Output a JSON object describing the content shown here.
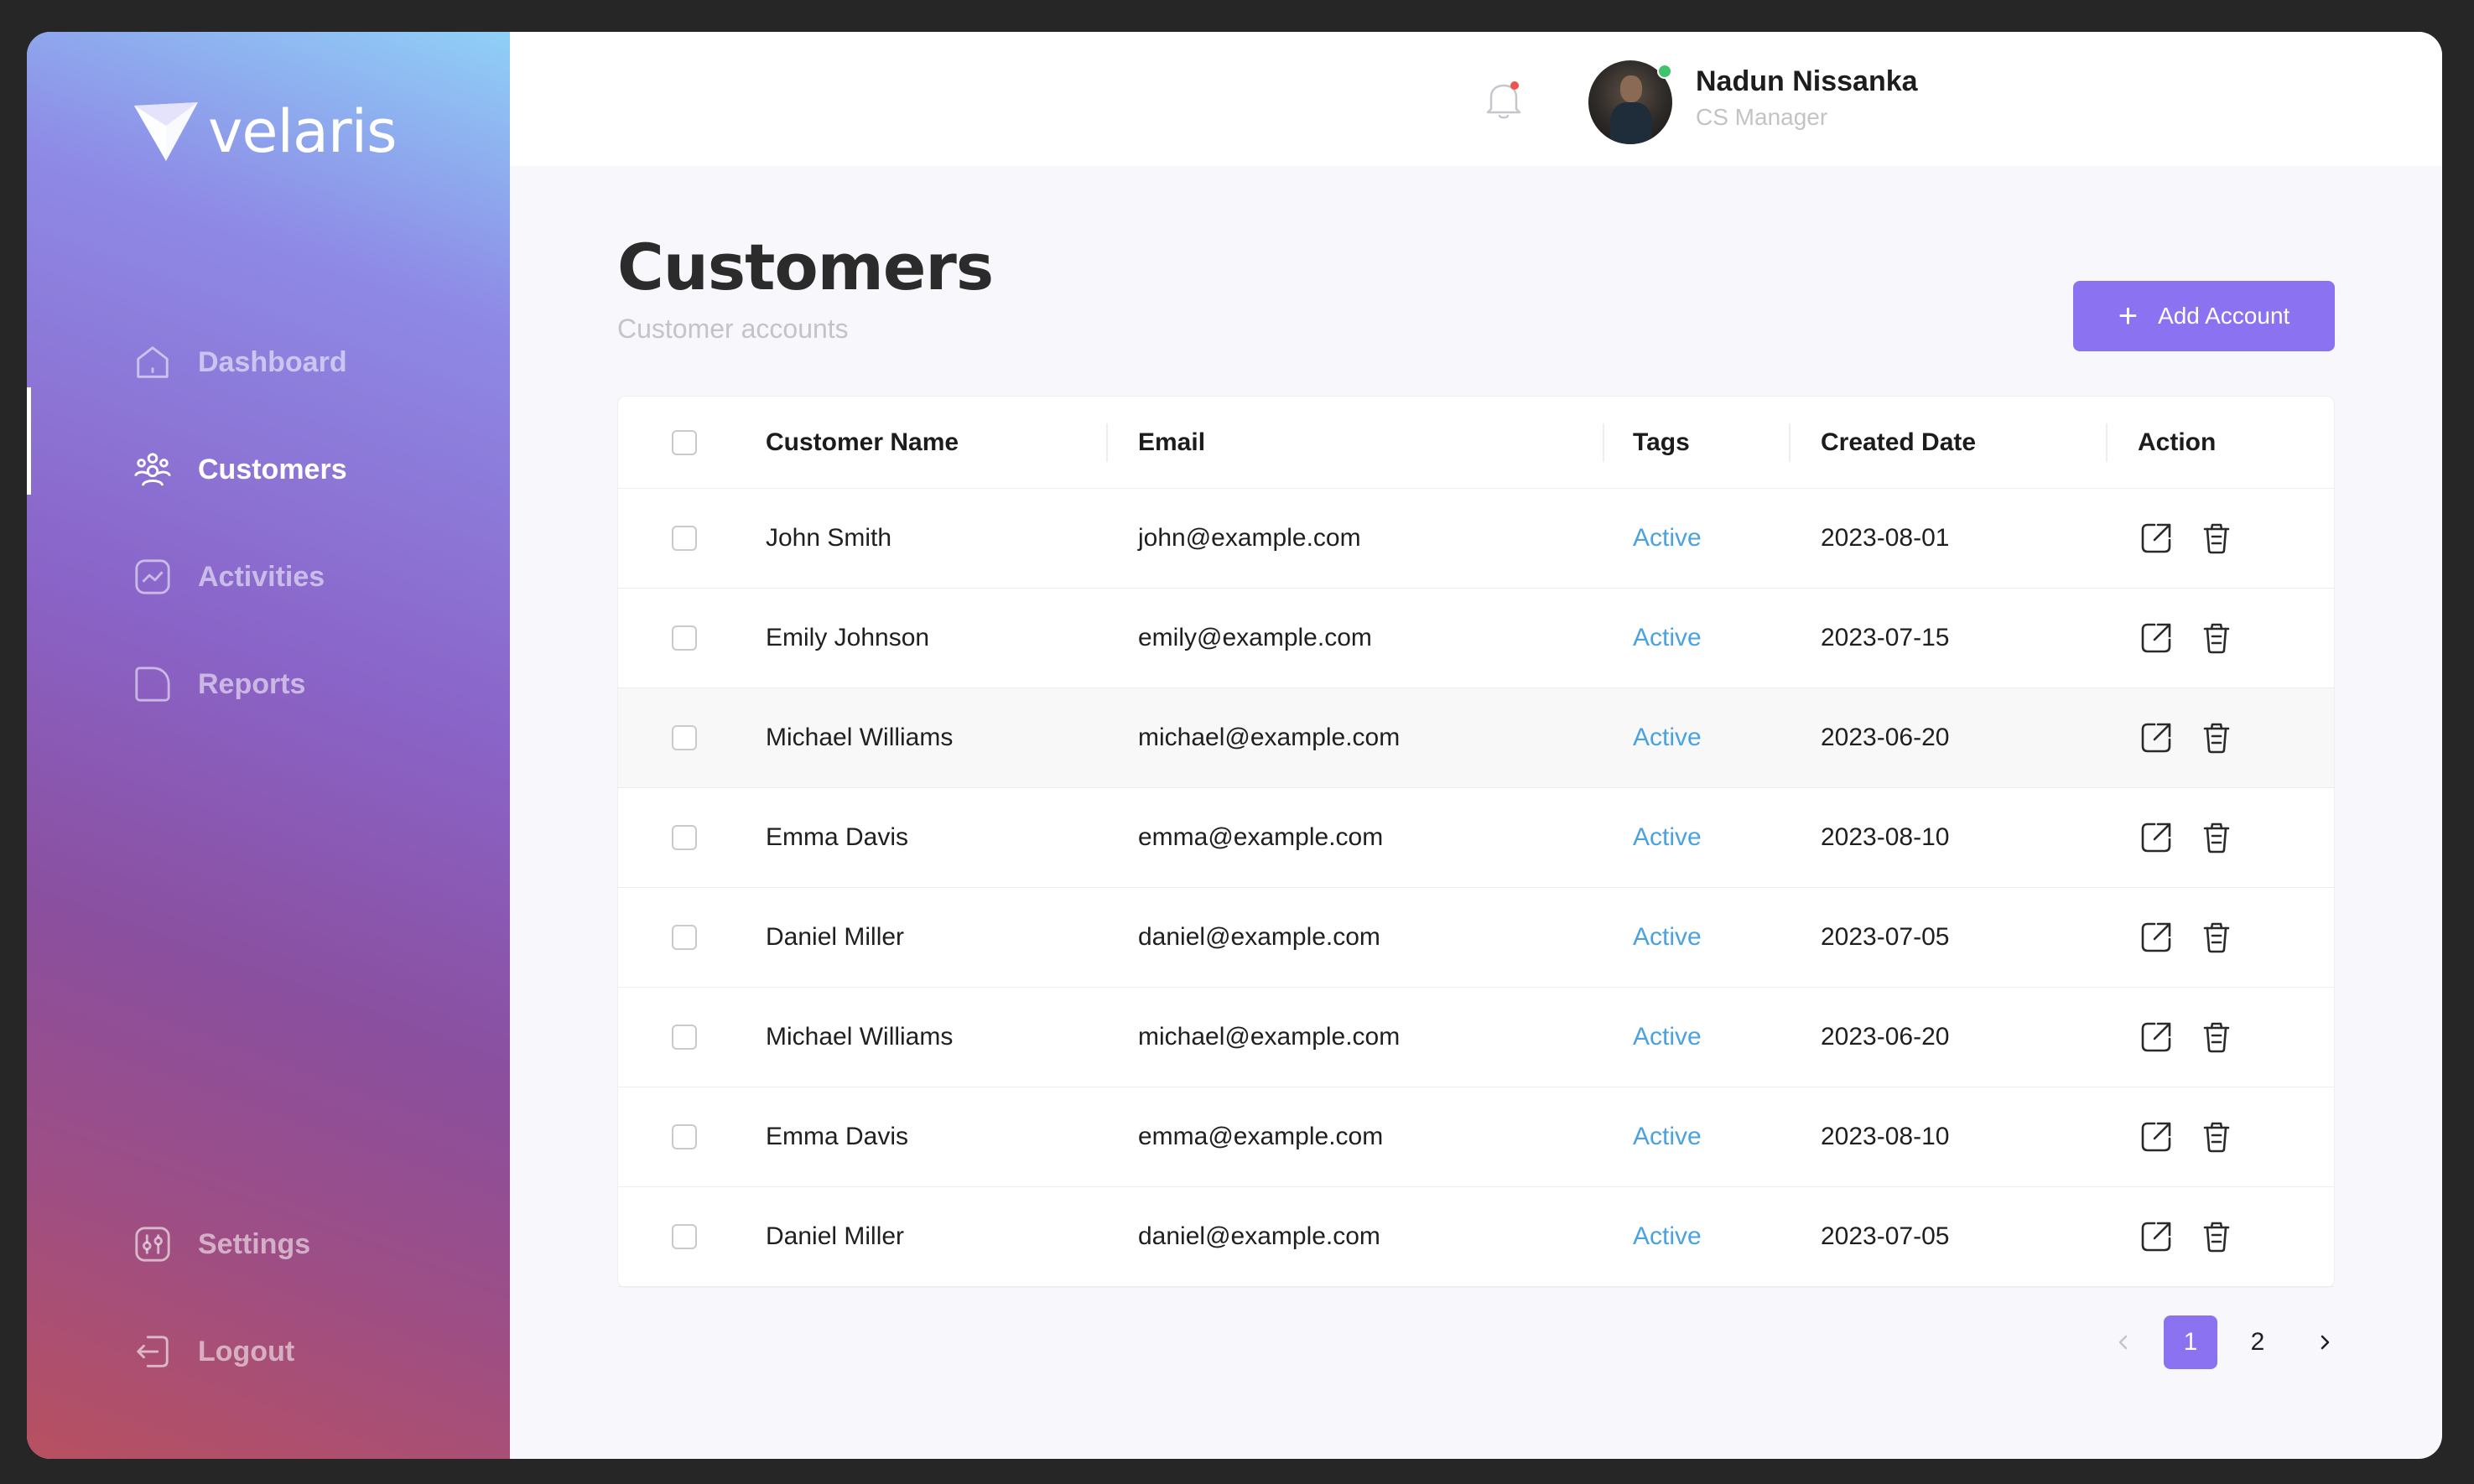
{
  "brand": {
    "name": "velaris"
  },
  "sidebar": {
    "items": [
      {
        "label": "Dashboard",
        "icon": "home-icon",
        "active": false
      },
      {
        "label": "Customers",
        "icon": "users-icon",
        "active": true
      },
      {
        "label": "Activities",
        "icon": "activity-chart-icon",
        "active": false
      },
      {
        "label": "Reports",
        "icon": "report-icon",
        "active": false
      }
    ],
    "bottom": [
      {
        "label": "Settings",
        "icon": "settings-icon"
      },
      {
        "label": "Logout",
        "icon": "logout-icon"
      }
    ]
  },
  "header": {
    "user": {
      "name": "Nadun Nissanka",
      "role": "CS Manager",
      "online": true
    },
    "notification_icon": "bell-icon"
  },
  "page": {
    "title": "Customers",
    "subtitle": "Customer accounts",
    "add_button": "Add Account"
  },
  "table": {
    "columns": [
      "Customer Name",
      "Email",
      "Tags",
      "Created Date",
      "Action"
    ],
    "rows": [
      {
        "name": "John Smith",
        "email": "john@example.com",
        "tag": "Active",
        "created": "2023-08-01"
      },
      {
        "name": "Emily Johnson",
        "email": "emily@example.com",
        "tag": "Active",
        "created": "2023-07-15"
      },
      {
        "name": "Michael Williams",
        "email": "michael@example.com",
        "tag": "Active",
        "created": "2023-06-20"
      },
      {
        "name": "Emma Davis",
        "email": "emma@example.com",
        "tag": "Active",
        "created": "2023-08-10"
      },
      {
        "name": "Daniel Miller",
        "email": "daniel@example.com",
        "tag": "Active",
        "created": "2023-07-05"
      },
      {
        "name": "Michael Williams",
        "email": "michael@example.com",
        "tag": "Active",
        "created": "2023-06-20"
      },
      {
        "name": "Emma Davis",
        "email": "emma@example.com",
        "tag": "Active",
        "created": "2023-08-10"
      },
      {
        "name": "Daniel Miller",
        "email": "daniel@example.com",
        "tag": "Active",
        "created": "2023-07-05"
      }
    ],
    "highlighted_row": 2
  },
  "pagination": {
    "pages": [
      "1",
      "2"
    ],
    "current": "1"
  },
  "colors": {
    "accent": "#8b72f1",
    "tag": "#4aa3e0",
    "online": "#3ec46d"
  }
}
